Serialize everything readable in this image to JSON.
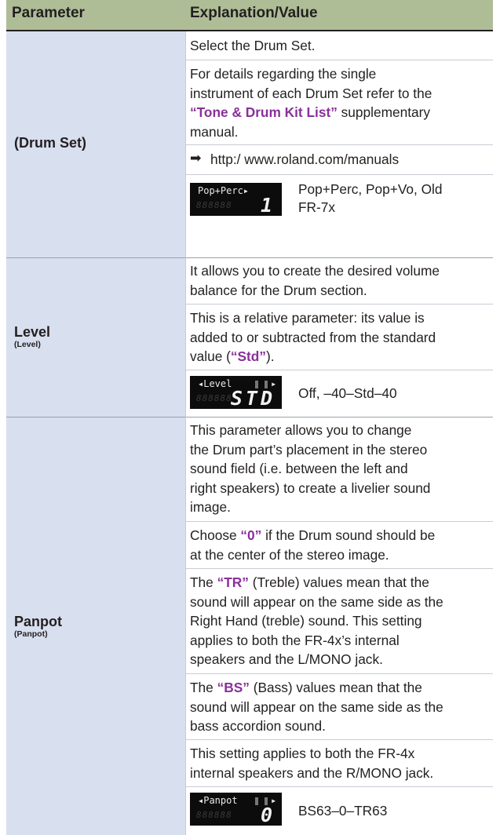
{
  "header": {
    "col1": "Parameter",
    "col2": "Explanation/Value"
  },
  "rows": {
    "drumset": {
      "name": "(Drum Set)",
      "p1": "Select the Drum Set.",
      "p2a": "For details regarding the single",
      "p2b": "instrument of each Drum Set refer to the",
      "p2c_kw": "“Tone & Drum Kit List”",
      "p2c_rest": " supplementary",
      "p2d": "manual.",
      "link_arrow": "➡",
      "link": "http:/ www.roland.com/manuals",
      "lcd_top": "Pop+Perc▸",
      "lcd_big": "1",
      "lcd_ghost": "888888",
      "value_a": "Pop+Perc, Pop+Vo, Old",
      "value_b": "FR-7x"
    },
    "level": {
      "name": "Level",
      "sub": "(Level)",
      "p1a": "It allows you to create the desired volume",
      "p1b": "balance for the Drum section.",
      "p2a": "This is a relative parameter: its value is",
      "p2b": "added to or subtracted from the standard",
      "p2c_pre": "value (",
      "p2c_kw": "“Std”",
      "p2c_post": ").",
      "lcd_top": "◂Level",
      "lcd_arrow": "▸",
      "lcd_big": "STD",
      "lcd_ghost": "888888",
      "value": "Off, –40–Std–40"
    },
    "panpot": {
      "name": "Panpot",
      "sub": "(Panpot)",
      "p1": [
        "This parameter allows you to change",
        "the Drum part’s placement in the stereo",
        "sound field (i.e. between the left and",
        "right speakers) to create a livelier sound",
        "image."
      ],
      "p2a_pre": "Choose ",
      "p2a_kw": "“0”",
      "p2a_post": " if the Drum sound should be",
      "p2b": "at the center of the stereo image.",
      "p3a_pre": "The ",
      "p3a_kw": "“TR”",
      "p3a_post": " (Treble) values mean that the",
      "p3": [
        "sound will appear on the same side as the",
        "Right Hand (treble) sound. This setting",
        "applies to both the FR-4x’s internal",
        "speakers and the L/MONO jack."
      ],
      "p4a_pre": "The ",
      "p4a_kw": "“BS”",
      "p4a_post": " (Bass) values mean that the",
      "p4": [
        "sound will appear on the same side as the",
        "bass accordion sound."
      ],
      "p5": [
        "This setting applies to both the FR-4x",
        "internal speakers and the R/MONO jack."
      ],
      "lcd_top": "◂Panpot",
      "lcd_arrow": "▸",
      "lcd_big": "0",
      "lcd_ghost": "888888",
      "value": "BS63–0–TR63"
    }
  },
  "colors": {
    "header_bg": "#aebd96",
    "param_bg": "#d8dfef",
    "keyword": "#8a2f9b"
  }
}
